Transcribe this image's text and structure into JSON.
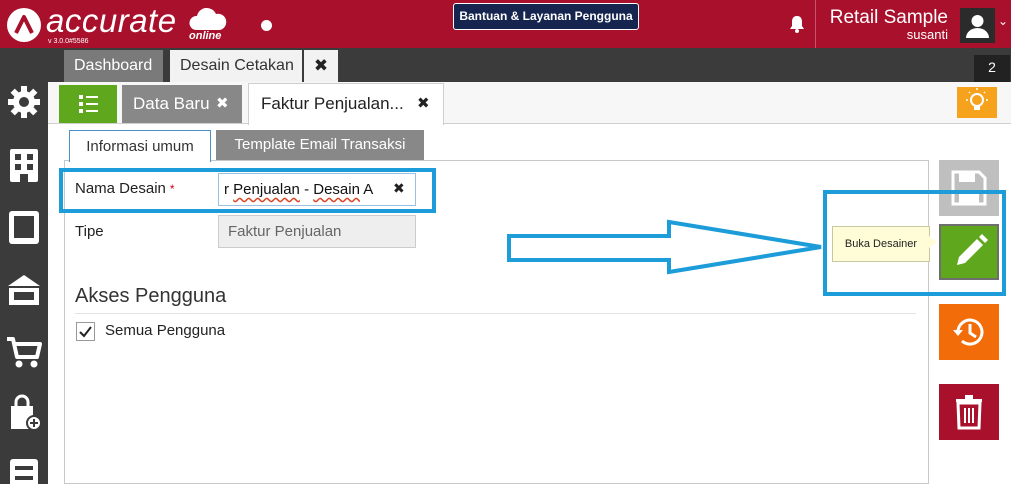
{
  "app": {
    "logo_text": "accurate",
    "logo_suffix": "online",
    "version": "v 3.0.0#5586",
    "help_label": "Bantuan & Layanan Pengguna",
    "company": "Retail Sample",
    "username": "susanti",
    "brand_color": "#a8102c"
  },
  "tabs": [
    {
      "label": "Dashboard",
      "active": false
    },
    {
      "label": "Desain Cetakan",
      "active": true
    }
  ],
  "tab_count": "2",
  "subtabs": [
    {
      "label": "Data Baru",
      "active": false
    },
    {
      "label": "Faktur Penjualan...",
      "active": true
    }
  ],
  "form_tabs": [
    {
      "label": "Informasi umum",
      "active": true
    },
    {
      "label": "Template Email Transaksi",
      "active": false
    }
  ],
  "form": {
    "nama_label": "Nama Desain",
    "required_mark": "*",
    "nama_value_prefix": "r ",
    "nama_value_underlined": "Penjualan",
    "nama_value_suffix": " - ",
    "nama_value_underlined2": "Desain",
    "nama_value_end": " A",
    "tipe_label": "Tipe",
    "tipe_value": "Faktur Penjualan",
    "akses_heading": "Akses Pengguna",
    "semua_label": "Semua Pengguna",
    "semua_checked": true
  },
  "tooltip": "Buka Desainer",
  "sidebar_icons": [
    "settings-icon",
    "company-icon",
    "ledger-icon",
    "bank-icon",
    "cart-icon",
    "purchase-bag-icon",
    "inventory-icon"
  ],
  "actions": [
    "save-icon",
    "edit-icon",
    "history-icon",
    "delete-icon"
  ]
}
